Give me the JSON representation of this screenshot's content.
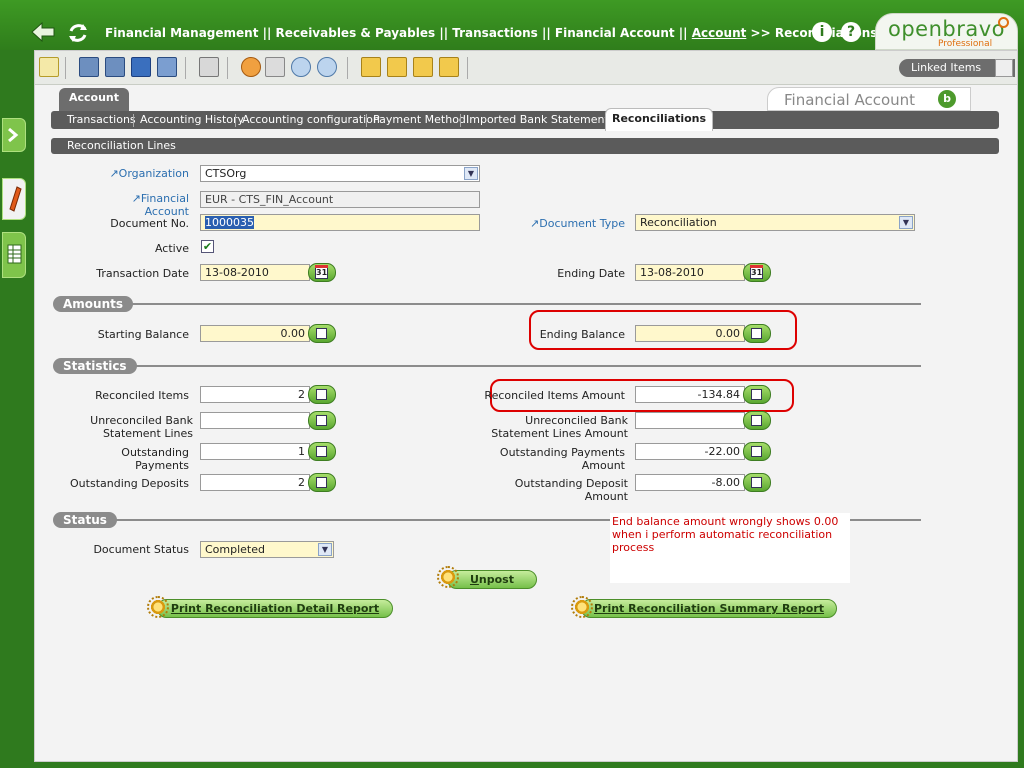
{
  "topbar": {
    "breadcrumb": {
      "part1": "Financial Management || Receivables & Payables || Transactions || Financial Account ||",
      "account_link": "Account",
      "part2": ">> Reconciliations"
    },
    "info_glyph": "i",
    "help_glyph": "?"
  },
  "logo": {
    "brand": "openbravo",
    "edition": "Professional"
  },
  "toolbar": {
    "linked_items_label": "Linked Items"
  },
  "tabs": {
    "account_tab": "Account",
    "window_title": "Financial Account",
    "subtabs": [
      "Transactions",
      "Accounting History",
      "Accounting configuration",
      "Payment Method",
      "Imported Bank Statements"
    ],
    "active_subtab": "Reconciliations"
  },
  "section_bar": "Reconciliation Lines",
  "form": {
    "organization": {
      "label": "Organization",
      "value": "CTSOrg"
    },
    "financial_account": {
      "label": "Financial Account",
      "value": "EUR - CTS_FIN_Account"
    },
    "document_no": {
      "label": "Document No.",
      "value": "1000035"
    },
    "document_type": {
      "label": "Document Type",
      "value": "Reconciliation"
    },
    "active": {
      "label": "Active",
      "checked": true,
      "glyph": "✔"
    },
    "transaction_date": {
      "label": "Transaction Date",
      "value": "13-08-2010"
    },
    "ending_date": {
      "label": "Ending Date",
      "value": "13-08-2010"
    },
    "calendar_glyph": "31"
  },
  "amounts": {
    "heading": "Amounts",
    "starting_balance": {
      "label": "Starting Balance",
      "value": "0.00"
    },
    "ending_balance": {
      "label": "Ending Balance",
      "value": "0.00"
    }
  },
  "statistics": {
    "heading": "Statistics",
    "reconciled_items": {
      "label": "Reconciled Items",
      "value": "2"
    },
    "reconciled_items_amount": {
      "label": "Reconciled Items Amount",
      "value": "-134.84"
    },
    "unreconciled_bank_lines": {
      "label_line1": "Unreconciled Bank",
      "label_line2": "Statement Lines",
      "value": ""
    },
    "unreconciled_bank_lines_amount": {
      "label_line1": "Unreconciled Bank",
      "label_line2": "Statement Lines Amount",
      "value": ""
    },
    "outstanding_payments": {
      "label": "Outstanding Payments",
      "value": "1"
    },
    "outstanding_payments_amount": {
      "label_line1": "Outstanding Payments",
      "label_line2": "Amount",
      "value": "-22.00"
    },
    "outstanding_deposits": {
      "label": "Outstanding Deposits",
      "value": "2"
    },
    "outstanding_deposit_amount": {
      "label_line1": "Outstanding Deposit",
      "label_line2": "Amount",
      "value": "-8.00"
    }
  },
  "status": {
    "heading": "Status",
    "document_status": {
      "label": "Document Status",
      "value": "Completed"
    }
  },
  "note": "End balance amount wrongly shows 0.00 when i perform automatic reconciliation process",
  "buttons": {
    "unpost_u": "U",
    "unpost_rest": "npost",
    "print_detail_p": "P",
    "print_detail_rest": "rint Reconciliation Detail Report",
    "print_summary_p": "P",
    "print_summary_r": "r",
    "print_summary_rest": "int Reconciliation Summary Report"
  },
  "colors": {
    "brand_green": "#2f7a1e",
    "required_label": "#2c6fb0",
    "annotation_red": "#cc0000"
  }
}
